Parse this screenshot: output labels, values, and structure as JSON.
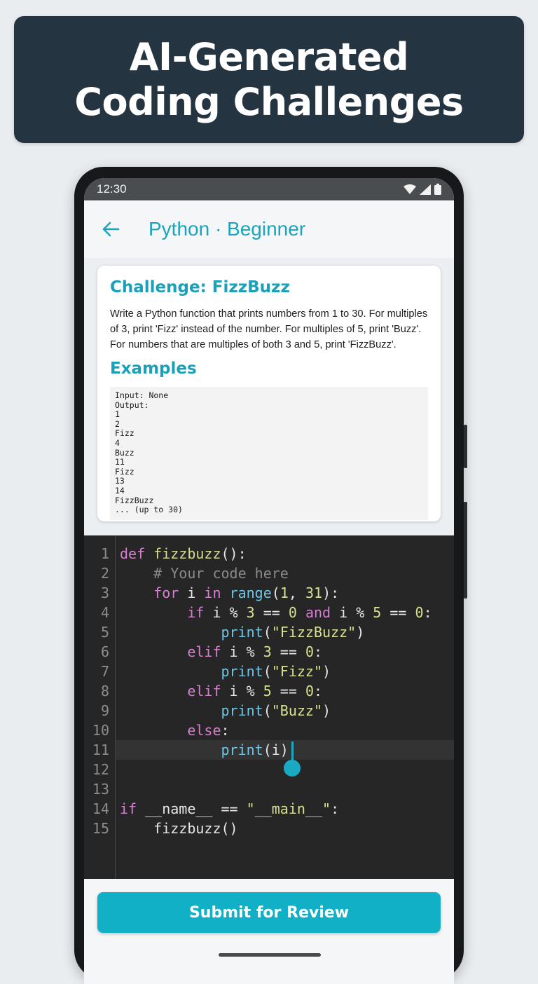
{
  "banner": {
    "line1": "AI-Generated",
    "line2": "Coding Challenges"
  },
  "status_bar": {
    "time": "12:30",
    "icons": [
      "wifi-icon",
      "signal-icon",
      "battery-icon"
    ]
  },
  "header": {
    "back_icon": "arrow-left-icon",
    "title": "Python · Beginner"
  },
  "challenge": {
    "title": "Challenge: FizzBuzz",
    "description": "Write a Python function that prints numbers from 1 to 30. For multiples of 3, print 'Fizz' instead of the number. For multiples of 5, print 'Buzz'. For numbers that are multiples of both 3 and 5, print 'FizzBuzz'.",
    "examples_title": "Examples",
    "examples": [
      "Input: None",
      "Output:",
      "1",
      "2",
      "Fizz",
      "4",
      "Buzz",
      "11",
      "Fizz",
      "13",
      "14",
      "FizzBuzz",
      "... (up to 30)"
    ]
  },
  "editor": {
    "active_line": 11,
    "lines": [
      {
        "num": "1",
        "tokens": [
          {
            "t": "def ",
            "c": "kw"
          },
          {
            "t": "fizzbuzz",
            "c": "fn"
          },
          {
            "t": "():",
            "c": ""
          }
        ]
      },
      {
        "num": "2",
        "tokens": [
          {
            "t": "    # Your code here",
            "c": "cm"
          }
        ]
      },
      {
        "num": "3",
        "tokens": [
          {
            "t": "    ",
            "c": ""
          },
          {
            "t": "for",
            "c": "kw"
          },
          {
            "t": " i ",
            "c": ""
          },
          {
            "t": "in",
            "c": "kw"
          },
          {
            "t": " ",
            "c": ""
          },
          {
            "t": "range",
            "c": "bi"
          },
          {
            "t": "(",
            "c": ""
          },
          {
            "t": "1",
            "c": "num"
          },
          {
            "t": ", ",
            "c": ""
          },
          {
            "t": "31",
            "c": "num"
          },
          {
            "t": "):",
            "c": ""
          }
        ]
      },
      {
        "num": "4",
        "tokens": [
          {
            "t": "        ",
            "c": ""
          },
          {
            "t": "if",
            "c": "kw"
          },
          {
            "t": " i % ",
            "c": ""
          },
          {
            "t": "3",
            "c": "num"
          },
          {
            "t": " == ",
            "c": ""
          },
          {
            "t": "0",
            "c": "num"
          },
          {
            "t": " ",
            "c": ""
          },
          {
            "t": "and",
            "c": "kw"
          },
          {
            "t": " i % ",
            "c": ""
          },
          {
            "t": "5",
            "c": "num"
          },
          {
            "t": " == ",
            "c": ""
          },
          {
            "t": "0",
            "c": "num"
          },
          {
            "t": ":",
            "c": ""
          }
        ]
      },
      {
        "num": "5",
        "tokens": [
          {
            "t": "            ",
            "c": ""
          },
          {
            "t": "print",
            "c": "bi"
          },
          {
            "t": "(",
            "c": ""
          },
          {
            "t": "\"FizzBuzz\"",
            "c": "str"
          },
          {
            "t": ")",
            "c": ""
          }
        ]
      },
      {
        "num": "6",
        "tokens": [
          {
            "t": "        ",
            "c": ""
          },
          {
            "t": "elif",
            "c": "kw"
          },
          {
            "t": " i % ",
            "c": ""
          },
          {
            "t": "3",
            "c": "num"
          },
          {
            "t": " == ",
            "c": ""
          },
          {
            "t": "0",
            "c": "num"
          },
          {
            "t": ":",
            "c": ""
          }
        ]
      },
      {
        "num": "7",
        "tokens": [
          {
            "t": "            ",
            "c": ""
          },
          {
            "t": "print",
            "c": "bi"
          },
          {
            "t": "(",
            "c": ""
          },
          {
            "t": "\"Fizz\"",
            "c": "str"
          },
          {
            "t": ")",
            "c": ""
          }
        ]
      },
      {
        "num": "8",
        "tokens": [
          {
            "t": "        ",
            "c": ""
          },
          {
            "t": "elif",
            "c": "kw"
          },
          {
            "t": " i % ",
            "c": ""
          },
          {
            "t": "5",
            "c": "num"
          },
          {
            "t": " == ",
            "c": ""
          },
          {
            "t": "0",
            "c": "num"
          },
          {
            "t": ":",
            "c": ""
          }
        ]
      },
      {
        "num": "9",
        "tokens": [
          {
            "t": "            ",
            "c": ""
          },
          {
            "t": "print",
            "c": "bi"
          },
          {
            "t": "(",
            "c": ""
          },
          {
            "t": "\"Buzz\"",
            "c": "str"
          },
          {
            "t": ")",
            "c": ""
          }
        ]
      },
      {
        "num": "10",
        "tokens": [
          {
            "t": "        ",
            "c": ""
          },
          {
            "t": "else",
            "c": "kw"
          },
          {
            "t": ":",
            "c": ""
          }
        ]
      },
      {
        "num": "11",
        "tokens": [
          {
            "t": "            ",
            "c": ""
          },
          {
            "t": "print",
            "c": "bi"
          },
          {
            "t": "(i)",
            "c": ""
          }
        ]
      },
      {
        "num": "12",
        "tokens": []
      },
      {
        "num": "13",
        "tokens": []
      },
      {
        "num": "14",
        "tokens": [
          {
            "t": "if",
            "c": "kw"
          },
          {
            "t": " __name__ == ",
            "c": ""
          },
          {
            "t": "\"__main__\"",
            "c": "str"
          },
          {
            "t": ":",
            "c": ""
          }
        ]
      },
      {
        "num": "15",
        "tokens": [
          {
            "t": "    fizzbuzz()",
            "c": ""
          }
        ]
      }
    ]
  },
  "actions": {
    "submit_label": "Submit for Review"
  },
  "colors": {
    "accent": "#1aa5bd",
    "banner_bg": "#253441",
    "editor_bg": "#262626",
    "submit_bg": "#12b0c6"
  }
}
